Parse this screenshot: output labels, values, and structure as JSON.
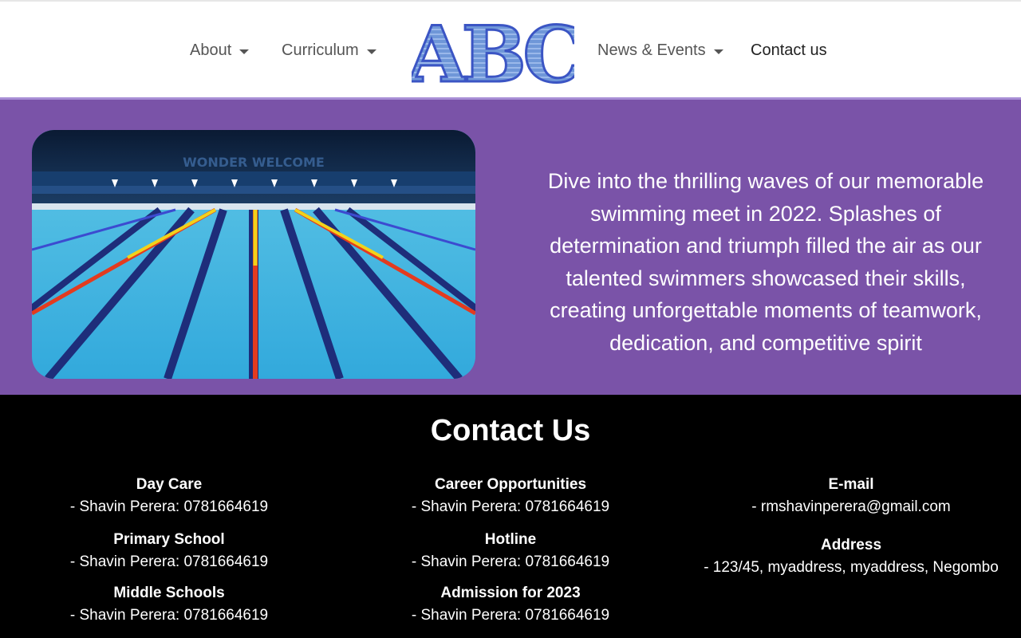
{
  "nav": {
    "items": [
      {
        "label": "About",
        "dropdown": true
      },
      {
        "label": "Curriculum",
        "dropdown": true
      },
      {
        "label": "News & Events",
        "dropdown": true
      },
      {
        "label": "Contact us",
        "dropdown": false
      }
    ],
    "logo_text": "ABC"
  },
  "hero": {
    "image_caption_text": "WONDER WELCOME",
    "text": "Dive into the thrilling waves of our memorable swimming meet in 2022. Splashes of determination and triumph filled the air as our talented swimmers showcased their skills, creating unforgettable moments of teamwork, dedication, and competitive spirit"
  },
  "contact": {
    "title": "Contact Us",
    "columns": [
      [
        {
          "heading": "Day Care",
          "value": "- Shavin Perera: 0781664619"
        },
        {
          "heading": "Primary School",
          "value": "- Shavin Perera: 0781664619"
        },
        {
          "heading": "Middle Schools",
          "value": "- Shavin Perera: 0781664619"
        }
      ],
      [
        {
          "heading": "Career Opportunities",
          "value": "- Shavin Perera: 0781664619"
        },
        {
          "heading": "Hotline",
          "value": "- Shavin Perera: 0781664619"
        },
        {
          "heading": "Admission for 2023",
          "value": "- Shavin Perera: 0781664619"
        }
      ],
      [
        {
          "heading": "E-mail",
          "value": "- rmshavinperera@gmail.com"
        },
        {
          "heading": "Address",
          "value": "- 123/45, myaddress, myaddress, Negombo"
        }
      ]
    ]
  },
  "colors": {
    "hero_bg": "#7a53a8",
    "footer_bg": "#000000",
    "logo_dark": "#3b55c4",
    "logo_light": "#6f97d8"
  }
}
